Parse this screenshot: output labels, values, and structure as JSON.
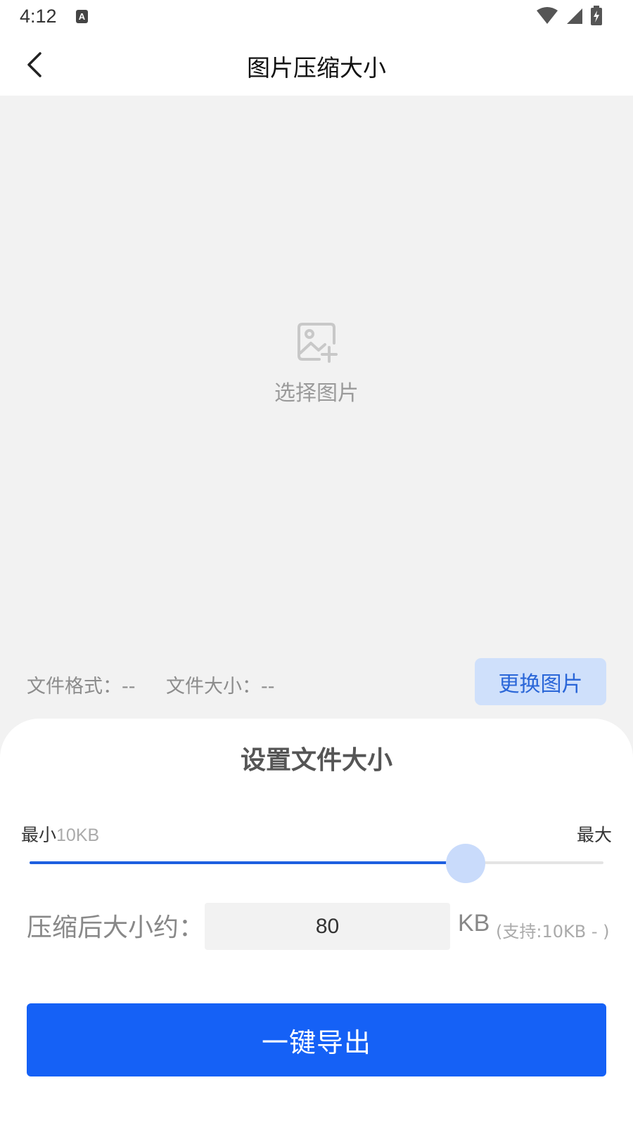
{
  "status_bar": {
    "time": "4:12",
    "notification_icon": "A",
    "icons": [
      "wifi-icon",
      "cellular-signal-icon",
      "battery-charging-icon"
    ]
  },
  "header": {
    "back_icon": "chevron-left-icon",
    "title": "图片压缩大小"
  },
  "preview": {
    "icon": "image-add-icon",
    "select_label": "选择图片"
  },
  "file_info": {
    "format_text": "文件格式：--",
    "size_text": "文件大小：--",
    "replace_label": "更换图片"
  },
  "settings": {
    "title": "设置文件大小",
    "min_label": "最小",
    "min_value": "10KB",
    "max_label": "最大",
    "slider_fraction": 0.76,
    "size_label": "压缩后大小约：",
    "size_value": "80",
    "unit": "KB",
    "support_text": "(支持:10KB - )",
    "export_label": "一键导出"
  },
  "colors": {
    "accent": "#1561f6",
    "slider_fill": "#1e5fe0",
    "thumb": "#c9dbfb",
    "replace_bg": "#cfe0fb",
    "replace_text": "#2a66d8",
    "background": "#f2f2f2"
  }
}
